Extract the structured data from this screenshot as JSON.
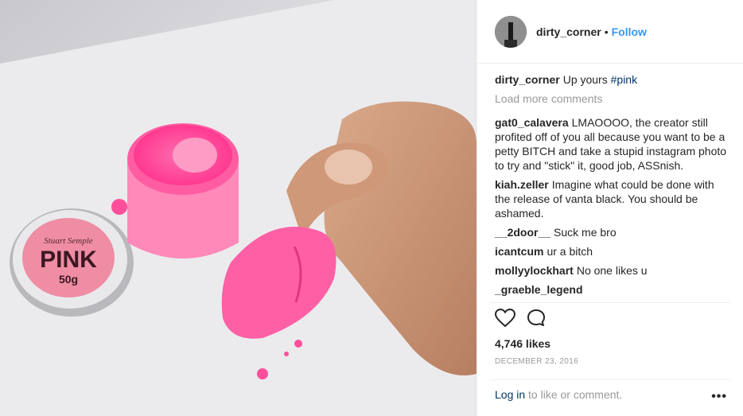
{
  "header": {
    "username": "dirty_corner",
    "separator": "•",
    "follow": "Follow"
  },
  "caption": {
    "username": "dirty_corner",
    "text": "Up yours",
    "hashtag": "#pink"
  },
  "load_more": "Load more comments",
  "comments": [
    {
      "user": "gat0_calavera",
      "text": "LMAOOOO, the creator still profited off of you all because you want to be a petty BITCH and take a stupid instagram photo to try and \"stick\" it, good job, ASSnish."
    },
    {
      "user": "kiah.zeller",
      "text": "Imagine what could be done with the release of vanta black. You should be ashamed."
    },
    {
      "user": "__2door__",
      "text": "Suck me bro"
    },
    {
      "user": "icantcum",
      "text": "ur a bitch"
    },
    {
      "user": "mollyylockhart",
      "text": "No one likes u"
    },
    {
      "user": "_graeble_legend",
      "text": ""
    }
  ],
  "likes": "4,746 likes",
  "date": "DECEMBER 23, 2016",
  "login": {
    "link": "Log in",
    "text": "to like or comment."
  },
  "more": "•••",
  "photo": {
    "jar_label_line1": "Stuart Semple",
    "jar_label_big": "PINK",
    "jar_label_weight": "50g"
  }
}
